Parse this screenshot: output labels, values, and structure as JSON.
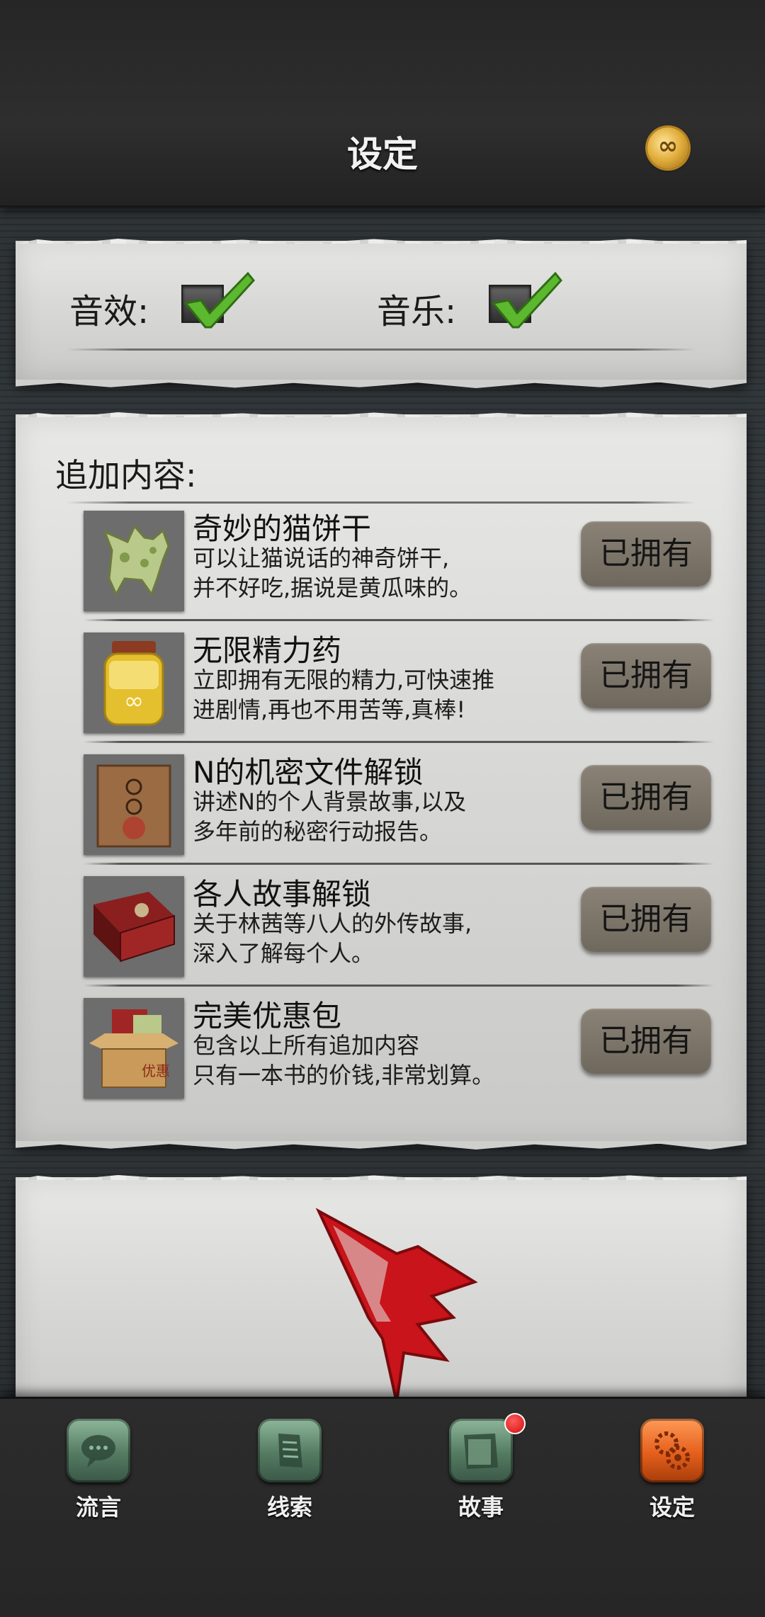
{
  "header": {
    "title": "设定",
    "currency_icon": "infinity-coin-icon",
    "currency_symbol": "∞"
  },
  "settings": {
    "sound_label": "音效:",
    "sound_enabled": true,
    "music_label": "音乐:",
    "music_enabled": true
  },
  "addons": {
    "title": "追加内容:",
    "items": [
      {
        "name": "奇妙的猫饼干",
        "desc_line1": "可以让猫说话的神奇饼干,",
        "desc_line2": "并不好吃,据说是黄瓜味的。",
        "button": "已拥有",
        "icon": "cat-cookie-icon"
      },
      {
        "name": "无限精力药",
        "desc_line1": "立即拥有无限的精力,可快速推",
        "desc_line2": "进剧情,再也不用苦等,真棒!",
        "button": "已拥有",
        "icon": "potion-jar-icon"
      },
      {
        "name": "N的机密文件解锁",
        "desc_line1": "讲述N的个人背景故事,以及",
        "desc_line2": "多年前的秘密行动报告。",
        "button": "已拥有",
        "icon": "secret-envelope-icon"
      },
      {
        "name": "各人故事解锁",
        "desc_line1": "关于林茜等八人的外传故事,",
        "desc_line2": "深入了解每个人。",
        "button": "已拥有",
        "icon": "story-book-icon"
      },
      {
        "name": "完美优惠包",
        "desc_line1": "包含以上所有追加内容",
        "desc_line2": "只有一本书的价钱,非常划算。",
        "button": "已拥有",
        "icon": "bundle-box-icon",
        "box_text": "优惠"
      }
    ]
  },
  "bottom_nav": {
    "items": [
      {
        "label": "流言",
        "icon": "speech-bubble-icon",
        "active": false
      },
      {
        "label": "线索",
        "icon": "note-paper-icon",
        "active": false
      },
      {
        "label": "故事",
        "icon": "story-folder-icon",
        "active": false,
        "has_badge": true
      },
      {
        "label": "设定",
        "icon": "gear-settings-icon",
        "active": true
      }
    ]
  },
  "colors": {
    "active_tab": "#e55f1c",
    "inactive_tab": "#547b62",
    "check_green": "#5cb82e",
    "logo_red": "#c8141a"
  }
}
